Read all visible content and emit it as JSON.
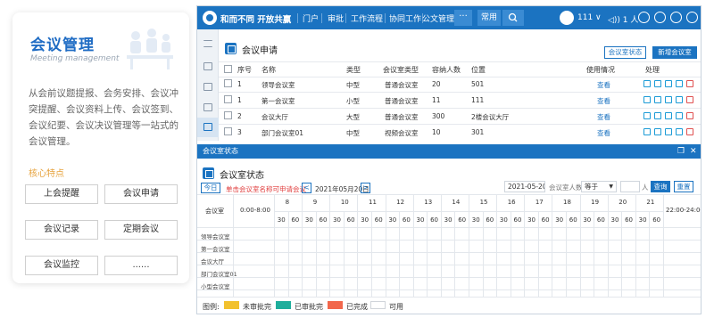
{
  "intro": {
    "title": "会议管理",
    "subtitle": "Meeting management",
    "description": "从会前议题提报、会务安排、会议冲突提醒、会议资料上传、会议签到、会议纪要、会议决议管理等一站式的会议管理。",
    "features_label": "核心特点",
    "features": [
      "上会提醒",
      "会议申请",
      "会议记录",
      "定期会议",
      "会议监控",
      "......"
    ]
  },
  "topbar": {
    "brand": "和而不同 开放共赢",
    "nav": [
      "门户",
      "审批",
      "工作流程",
      "协同工作",
      "公文管理"
    ],
    "more": "···",
    "favorite": "常用",
    "user": "111",
    "user_caret": "∨",
    "audio": "◁)) 1 人"
  },
  "panel": {
    "title": "会议申请",
    "btn_status": "会议室状态",
    "btn_new": "新增会议室",
    "columns": [
      "序号",
      "名称",
      "类型",
      "会议室类型",
      "容纳人数",
      "位置",
      "使用情况",
      "处理"
    ],
    "rows": [
      {
        "no": "1",
        "name": "领导会议室",
        "type": "中型",
        "room_type": "普通会议室",
        "capacity": "20",
        "location": "501",
        "usage": "查看"
      },
      {
        "no": "1",
        "name": "第一会议室",
        "type": "小型",
        "room_type": "普通会议室",
        "capacity": "11",
        "location": "111",
        "usage": "查看"
      },
      {
        "no": "2",
        "name": "会议大厅",
        "type": "大型",
        "room_type": "普通会议室",
        "capacity": "300",
        "location": "2楼会议大厅",
        "usage": "查看"
      },
      {
        "no": "3",
        "name": "部门会议室01",
        "type": "中型",
        "room_type": "视频会议室",
        "capacity": "10",
        "location": "301",
        "usage": "查看"
      }
    ]
  },
  "status": {
    "bar_title": "会议室状态",
    "title": "会议室状态",
    "today": "今日",
    "hint": "单击会议室名称可申请会议",
    "prev": "<",
    "next": ">",
    "date_label": "2021年05月20日",
    "date_value": "2021-05-20",
    "cap_label": "会议室人数:",
    "cap_op": "等于",
    "cap_unit": "人",
    "query": "查询",
    "reset": "重置",
    "room_header": "会议室",
    "early_slot": "0:00-8:00",
    "late_slot": "22:00-24:00",
    "hours": [
      "8",
      "9",
      "10",
      "11",
      "12",
      "13",
      "14",
      "15",
      "16",
      "17",
      "18",
      "19",
      "20",
      "21"
    ],
    "halves": [
      "30",
      "60"
    ],
    "rooms": [
      "领导会议室",
      "第一会议室",
      "会议大厅",
      "部门会议室01",
      "小型会议室"
    ],
    "legend_title": "图例:",
    "legend": [
      {
        "label": "未审批完",
        "color": "#f2c12e"
      },
      {
        "label": "已审批完",
        "color": "#1fae9c"
      },
      {
        "label": "已完成",
        "color": "#f2674c"
      },
      {
        "label": "可用",
        "color": "#ffffff"
      }
    ]
  }
}
